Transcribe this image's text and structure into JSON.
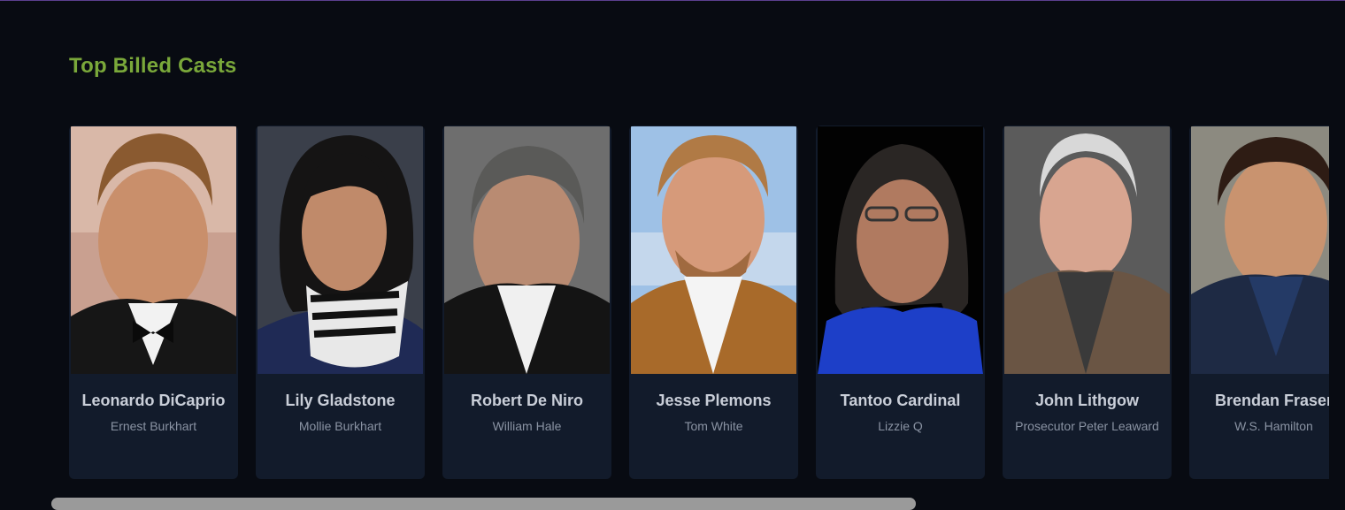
{
  "section": {
    "title": "Top Billed Casts"
  },
  "cast": [
    {
      "name": "Leonardo DiCaprio",
      "role": "Ernest Burkhart"
    },
    {
      "name": "Lily Gladstone",
      "role": "Mollie Burkhart"
    },
    {
      "name": "Robert De Niro",
      "role": "William Hale"
    },
    {
      "name": "Jesse Plemons",
      "role": "Tom White"
    },
    {
      "name": "Tantoo Cardinal",
      "role": "Lizzie Q"
    },
    {
      "name": "John Lithgow",
      "role": "Prosecutor Peter Leaward"
    },
    {
      "name": "Brendan Fraser",
      "role": "W.S. Hamilton"
    }
  ],
  "colors": {
    "background": "#080b12",
    "card": "#121b2b",
    "title": "#7aa83a",
    "name": "#c9ced8",
    "role": "#8a93a3",
    "scrollbar": "#9a9a9a"
  }
}
